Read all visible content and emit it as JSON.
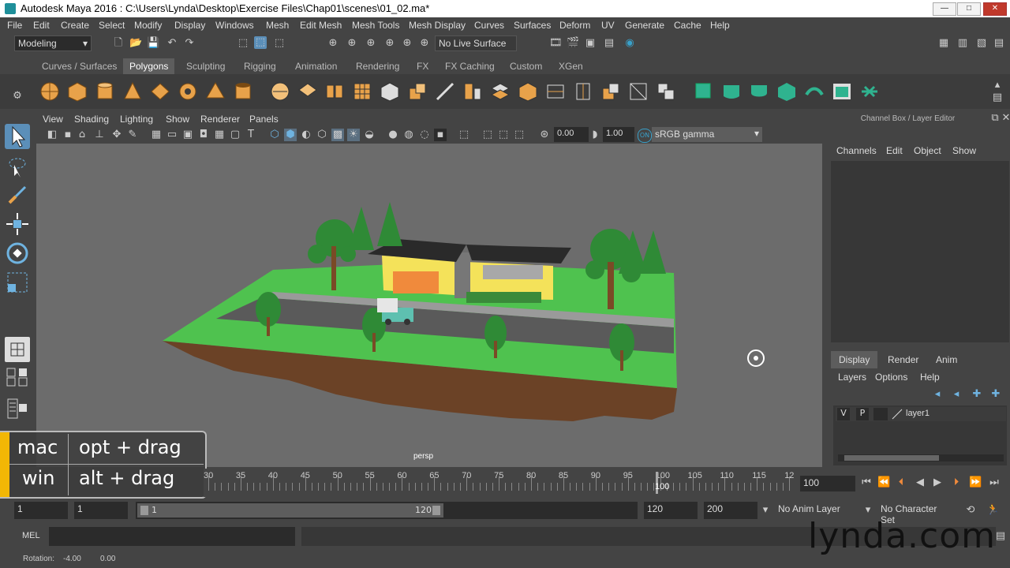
{
  "window": {
    "title": "Autodesk Maya 2016 : C:\\Users\\Lynda\\Desktop\\Exercise Files\\Chap01\\scenes\\01_02.ma*",
    "minimize": "—",
    "maximize": "□",
    "close": "✕"
  },
  "menubar": [
    "File",
    "Edit",
    "Create",
    "Select",
    "Modify",
    "Display",
    "Windows",
    "Mesh",
    "Edit Mesh",
    "Mesh Tools",
    "Mesh Display",
    "Curves",
    "Surfaces",
    "Deform",
    "UV",
    "Generate",
    "Cache",
    "Help"
  ],
  "statusline": {
    "menuset": "Modeling",
    "live_surface": "No Live Surface"
  },
  "shelf_tabs": [
    "Curves / Surfaces",
    "Polygons",
    "Sculpting",
    "Rigging",
    "Animation",
    "Rendering",
    "FX",
    "FX Caching",
    "Custom",
    "XGen"
  ],
  "shelf_active": "Polygons",
  "viewport": {
    "menus": [
      "View",
      "Shading",
      "Lighting",
      "Show",
      "Renderer",
      "Panels"
    ],
    "exposure": "0.00",
    "gamma": "1.00",
    "colorspace": "sRGB gamma",
    "camera_label": "persp"
  },
  "channel_box": {
    "title": "Channel Box / Layer Editor",
    "menus": [
      "Channels",
      "Edit",
      "Object",
      "Show"
    ]
  },
  "layer_editor": {
    "tabs": [
      "Display",
      "Render",
      "Anim"
    ],
    "active_tab": "Display",
    "menus": [
      "Layers",
      "Options",
      "Help"
    ],
    "layer": {
      "v": "V",
      "p": "P",
      "name": "layer1"
    }
  },
  "overlay": {
    "rows": [
      {
        "platform": "mac",
        "shortcut": "opt + drag"
      },
      {
        "platform": "win",
        "shortcut": "alt + drag"
      }
    ]
  },
  "timeline": {
    "tick_labels": [
      "30",
      "35",
      "40",
      "45",
      "50",
      "55",
      "60",
      "65",
      "70",
      "75",
      "80",
      "85",
      "90",
      "95",
      "100",
      "105",
      "110",
      "115",
      "12"
    ],
    "current_frame_marker": "100",
    "current_frame_field": "100"
  },
  "range": {
    "start": "1",
    "anim_start": "1",
    "slider_start": "1",
    "slider_end": "120",
    "anim_end": "120",
    "end": "200",
    "anim_layer": "No Anim Layer",
    "character_set": "No Character Set"
  },
  "mel": {
    "label": "MEL"
  },
  "helpline": {
    "label": "Rotation:",
    "x": "-4.00",
    "y": "0.00"
  },
  "watermark": "lynda.com",
  "colors": {
    "accent": "#f2b705",
    "grass": "#4fc24f",
    "road": "#5a5a5a",
    "house_wall": "#f4e25a",
    "roof": "#2a2a2a"
  }
}
